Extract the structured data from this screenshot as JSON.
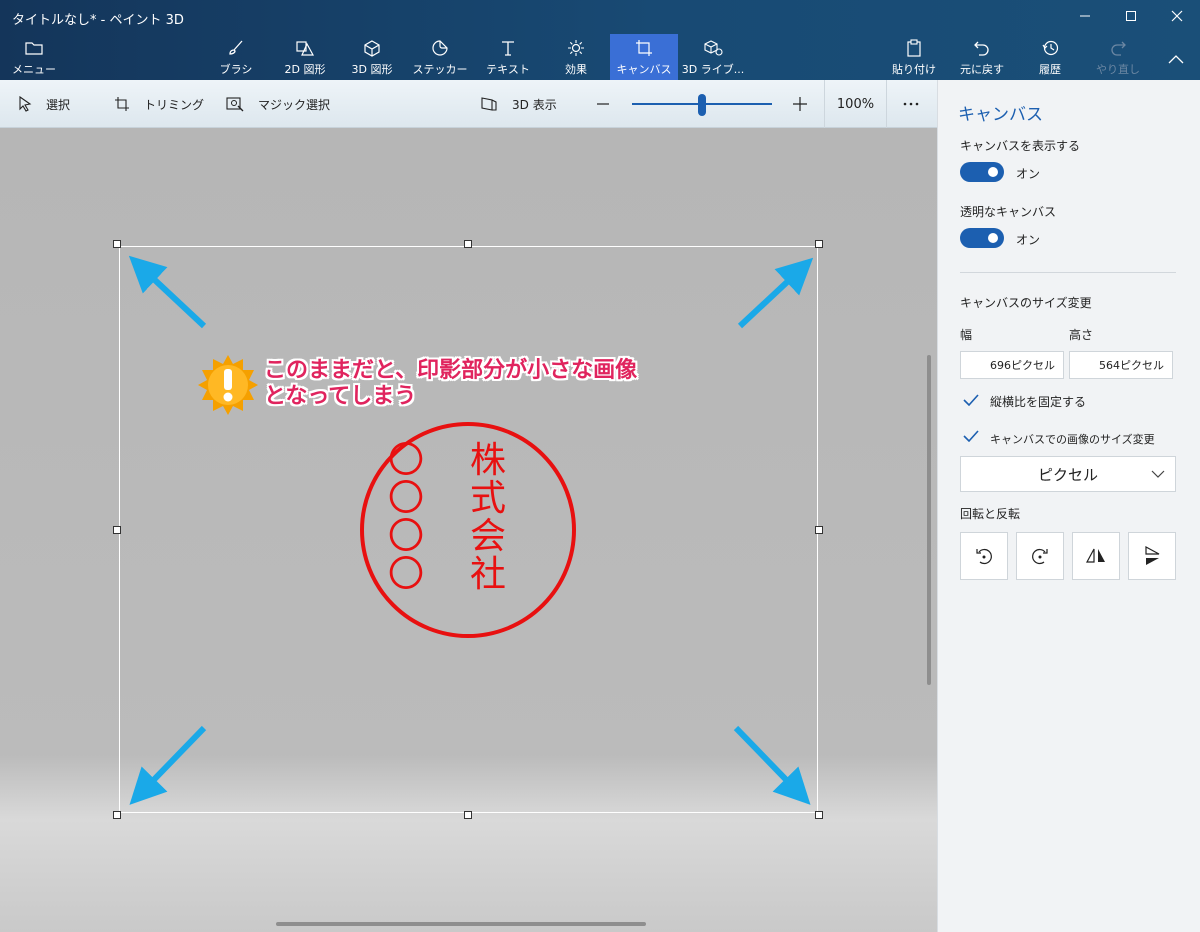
{
  "window": {
    "title": "タイトルなし* - ペイント 3D"
  },
  "ribbon": {
    "menu_label": "メニュー",
    "tools": [
      {
        "label": "ブラシ",
        "icon": "brush-icon"
      },
      {
        "label": "2D 図形",
        "icon": "2d-shapes-icon"
      },
      {
        "label": "3D 図形",
        "icon": "3d-shapes-icon"
      },
      {
        "label": "ステッカー",
        "icon": "sticker-icon"
      },
      {
        "label": "テキスト",
        "icon": "text-icon"
      },
      {
        "label": "効果",
        "icon": "effects-icon"
      },
      {
        "label": "キャンバス",
        "icon": "canvas-icon",
        "active": true
      },
      {
        "label": "3D ライブ...",
        "icon": "3d-library-icon"
      }
    ],
    "paste_label": "貼り付け",
    "undo_label": "元に戻す",
    "history_label": "履歴",
    "redo_label": "やり直し"
  },
  "toolbar": {
    "select_label": "選択",
    "trim_label": "トリミング",
    "magic_select_label": "マジック選択",
    "view3d_label": "3D 表示",
    "zoom_percent": "100%",
    "zoom_level": 0.5
  },
  "annotation": {
    "line1": "このままだと、印影部分が小さな画像",
    "line2": "となってしまう"
  },
  "stamp": {
    "right_column": [
      "株",
      "式",
      "会",
      "社"
    ],
    "left_column": [
      "〇",
      "〇",
      "〇",
      "〇"
    ]
  },
  "panel": {
    "title": "キャンバス",
    "show_canvas_label": "キャンバスを表示する",
    "show_canvas_state": "オン",
    "transparent_label": "透明なキャンバス",
    "transparent_state": "オン",
    "resize_label": "キャンバスのサイズ変更",
    "width_label": "幅",
    "height_label": "高さ",
    "width_value": "696ピクセル",
    "height_value": "564ピクセル",
    "lock_ratio_label": "縦横比を固定する",
    "resize_image_label": "キャンバスでの画像のサイズ変更",
    "unit_value": "ピクセル",
    "rotate_label": "回転と反転"
  },
  "colors": {
    "accent": "#1c5fb0",
    "annotation": "#e0245e",
    "stamp": "#e81010",
    "arrow": "#1aa9e8"
  }
}
